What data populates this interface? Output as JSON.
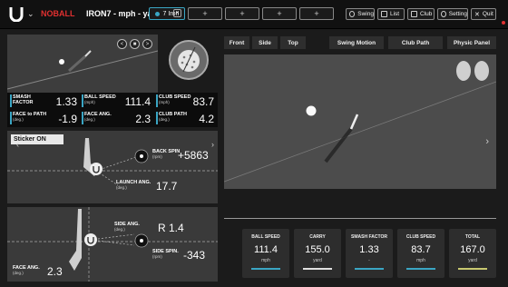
{
  "header": {
    "dropdown_icon": "chevron-down-icon",
    "status": "NOBALL",
    "status_color": "#e03030",
    "title": "IRON7 - mph - yard",
    "club_tabs": [
      {
        "label": "7 Iron",
        "active": true
      },
      {
        "label": "+"
      },
      {
        "label": "+"
      },
      {
        "label": "+"
      },
      {
        "label": "+"
      }
    ],
    "buttons": {
      "swing": "Swing",
      "list": "List",
      "club": "Club",
      "setting": "Setting",
      "quit": "Quit"
    }
  },
  "camera_nav": [
    "<",
    "■",
    ">"
  ],
  "stats": {
    "smash_factor": {
      "label1": "SMASH",
      "label2": "FACTOR",
      "value": "1.33"
    },
    "ball_speed": {
      "label1": "BALL SPEED",
      "unit": "(mph)",
      "value": "111.4"
    },
    "club_speed": {
      "label1": "CLUB SPEED",
      "unit": "(mph)",
      "value": "83.7"
    },
    "face_to_path": {
      "label1": "FACE to PATH",
      "unit": "(deg.)",
      "value": "-1.9"
    },
    "face_ang": {
      "label1": "FACE ANG.",
      "unit": "(deg.)",
      "value": "2.3"
    },
    "club_path": {
      "label1": "CLUB PATH",
      "unit": "(deg.)",
      "value": "4.2"
    }
  },
  "spin_panel": {
    "sticker": "Sticker ON",
    "back_spin_label": "BACK SPIN",
    "back_spin_unit": "(rpm)",
    "back_spin_value": "+5863",
    "launch_label": "LAUNCH ANG.",
    "launch_unit": "(deg.)",
    "launch_value": "17.7"
  },
  "side_panel": {
    "side_ang_label": "SIDE ANG.",
    "side_ang_unit": "(deg.)",
    "side_ang_value": "R 1.4",
    "side_spin_label": "SIDE SPIN.",
    "side_spin_unit": "(rpm)",
    "side_spin_value": "-343",
    "face_ang_label": "FACE ANG.",
    "face_ang_unit": "(deg.)",
    "face_ang_value": "2.3"
  },
  "view_tabs": {
    "front": "Front",
    "side": "Side",
    "top": "Top",
    "swing_motion": "Swing Motion",
    "club_path": "Club Path",
    "physic_panel": "Physic Panel"
  },
  "cards": [
    {
      "label": "BALL SPEED",
      "value": "111.4",
      "unit": "mph",
      "color": "#3aa6c4"
    },
    {
      "label": "CARRY",
      "value": "155.0",
      "unit": "yard",
      "color": "#e0e0e0"
    },
    {
      "label": "SMASH FACTOR",
      "value": "1.33",
      "unit": "-",
      "color": "#3aa6c4"
    },
    {
      "label": "CLUB SPEED",
      "value": "83.7",
      "unit": "mph",
      "color": "#3aa6c4"
    },
    {
      "label": "TOTAL",
      "value": "167.0",
      "unit": "yard",
      "color": "#c8c870"
    }
  ]
}
